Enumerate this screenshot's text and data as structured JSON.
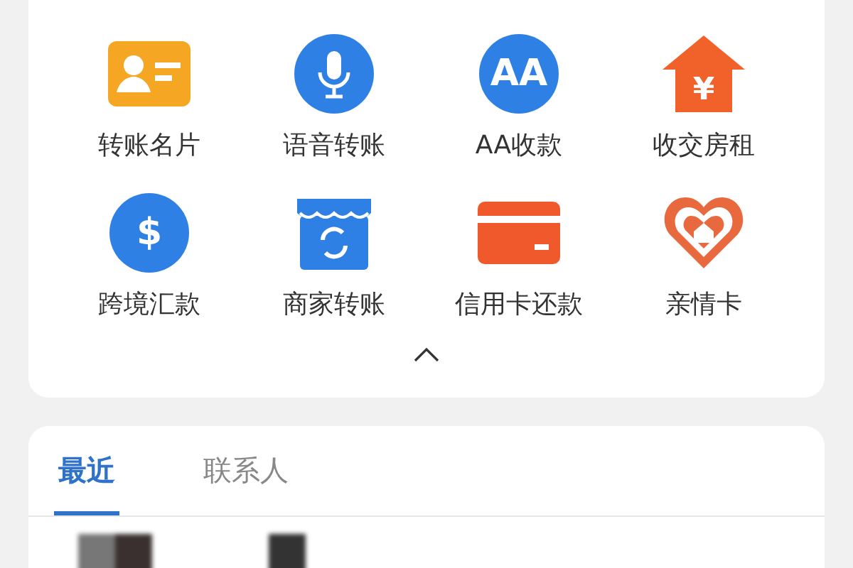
{
  "services": [
    {
      "label": "转账名片"
    },
    {
      "label": "语音转账"
    },
    {
      "label": "AA收款",
      "icon_text": "AA"
    },
    {
      "label": "收交房租",
      "icon_text": "¥"
    },
    {
      "label": "跨境汇款",
      "icon_text": "$"
    },
    {
      "label": "商家转账"
    },
    {
      "label": "信用卡还款"
    },
    {
      "label": "亲情卡"
    }
  ],
  "tabs": [
    {
      "label": "最近",
      "selected": true
    },
    {
      "label": "联系人",
      "selected": false
    }
  ]
}
